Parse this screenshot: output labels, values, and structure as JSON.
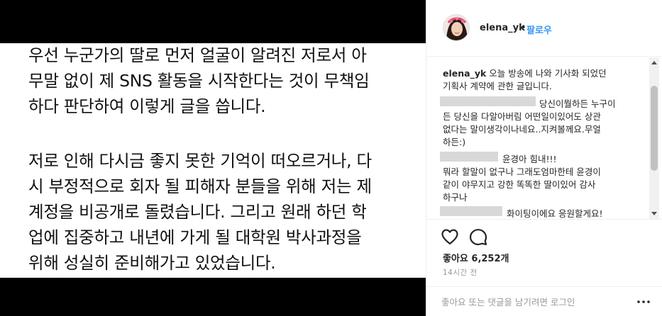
{
  "image_text": {
    "paragraph1": "우선 누군가의 딸로 먼저 얼굴이 알려진 저로서 아\n무말 없이 제 SNS 활동을 시작한다는 것이 무책임\n하다 판단하여 이렇게 글을 씁니다.",
    "paragraph2": "저로 인해 다시금 좋지 못한 기억이 떠오르거나, 다\n시 부정적으로 회자 될 피해자 분들을 위해 저는 제\n계정을 비공개로 돌렸습니다. 그리고 원래 하던 학\n업에 집중하고 내년에 가게 될 대학원 박사과정을\n위해 성실히 준비해가고 있었습니다."
  },
  "header": {
    "username": "elena_yk",
    "separator": "•",
    "follow_label": "팔로우",
    "avatar_icon": "profile-avatar-icon"
  },
  "caption": {
    "username": "elena_yk",
    "line1": "오늘 방송에 나와 기사화 되었던",
    "line2": "기획사 계약에 관한 글입니다."
  },
  "comments": [
    {
      "lines": [
        "당신이뭘하든 누구이",
        "든 당신을 다알아버림 어떤일이있어도 상관",
        "없다는 말이생각이나네요..지켜볼께요.무얼",
        "하든:)"
      ]
    },
    {
      "lines": [
        "윤경아 힘내!!!",
        "뭐라 할말이 없구나 그래도엄마한테 윤경이",
        "같이 야무지고 강한 똑똑한 딸이있어 감사",
        "하구나"
      ]
    },
    {
      "lines": [
        "화이팅이에요 응원할게요!"
      ]
    }
  ],
  "actions": {
    "like_icon": "heart-icon",
    "comment_icon": "comment-icon",
    "likes_text": "좋아요 6,252개",
    "time_text": "14시간 전"
  },
  "add_comment": {
    "placeholder": "좋아요 또는 댓글을 남기려면 로그인",
    "more_icon": "more-options-icon"
  },
  "colors": {
    "accent": "#3897f0",
    "text": "#262626",
    "muted": "#999999"
  }
}
